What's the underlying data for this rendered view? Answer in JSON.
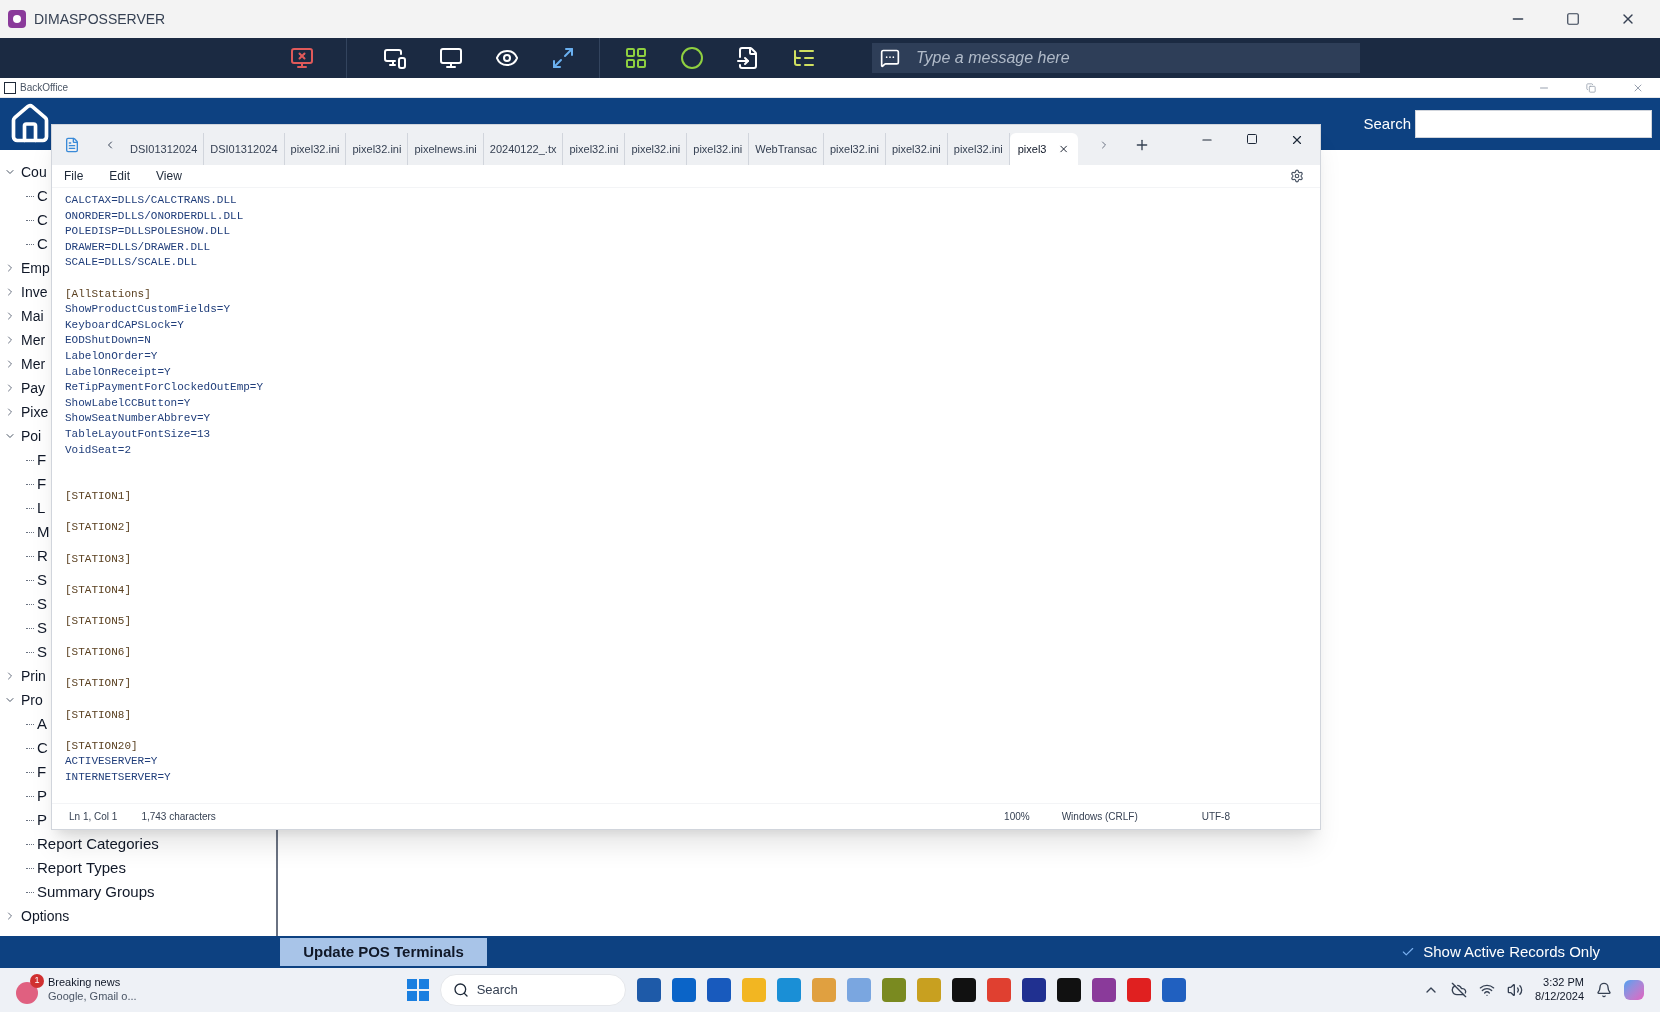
{
  "window": {
    "title": "DIMASPOSSERVER"
  },
  "remote_toolbar": {
    "message_field": {
      "placeholder": "Type a message here"
    }
  },
  "backoffice": {
    "title": "BackOffice",
    "search": {
      "label": "Search"
    },
    "tree": [
      {
        "label": "Cou",
        "expanded": true,
        "children": [
          {
            "label": "C"
          },
          {
            "label": "C"
          },
          {
            "label": "C"
          }
        ]
      },
      {
        "label": "Emp",
        "expanded": false
      },
      {
        "label": "Inve",
        "expanded": false
      },
      {
        "label": "Mai",
        "expanded": false
      },
      {
        "label": "Mer",
        "expanded": false
      },
      {
        "label": "Mer",
        "expanded": false
      },
      {
        "label": "Pay",
        "expanded": false
      },
      {
        "label": "Pixe",
        "expanded": false
      },
      {
        "label": "Poi",
        "expanded": true,
        "children": [
          {
            "label": "F"
          },
          {
            "label": "F"
          },
          {
            "label": "L"
          },
          {
            "label": "M"
          },
          {
            "label": "R"
          },
          {
            "label": "S"
          },
          {
            "label": "S"
          },
          {
            "label": "S"
          },
          {
            "label": "S"
          }
        ]
      },
      {
        "label": "Prin",
        "expanded": false
      },
      {
        "label": "Pro",
        "expanded": true,
        "children": [
          {
            "label": "A"
          },
          {
            "label": "C"
          },
          {
            "label": "F"
          },
          {
            "label": "P"
          },
          {
            "label": "P"
          },
          {
            "label": "Report Categories"
          },
          {
            "label": "Report Types"
          },
          {
            "label": "Summary Groups"
          }
        ]
      },
      {
        "label": "Options",
        "expanded": false
      }
    ],
    "update_button": "Update POS Terminals",
    "active_only": {
      "label": "Show Active Records Only",
      "checked": true
    }
  },
  "notepad": {
    "tabs": [
      {
        "label": "DSI01312024",
        "selected": false
      },
      {
        "label": "DSI01312024",
        "selected": false
      },
      {
        "label": "pixel32.ini",
        "selected": false
      },
      {
        "label": "pixel32.ini",
        "selected": false
      },
      {
        "label": "pixelnews.ini",
        "selected": false
      },
      {
        "label": "20240122_.tx",
        "selected": false
      },
      {
        "label": "pixel32.ini",
        "selected": false
      },
      {
        "label": "pixel32.ini",
        "selected": false
      },
      {
        "label": "pixel32.ini",
        "selected": false
      },
      {
        "label": "WebTransac",
        "selected": false
      },
      {
        "label": "pixel32.ini",
        "selected": false
      },
      {
        "label": "pixel32.ini",
        "selected": false
      },
      {
        "label": "pixel32.ini",
        "selected": false
      },
      {
        "label": "pixel3",
        "selected": true
      }
    ],
    "menu": [
      "File",
      "Edit",
      "View"
    ],
    "lines": [
      {
        "kind": "entry",
        "text": "CALCTAX=DLLS/CALCTRANS.DLL"
      },
      {
        "kind": "entry",
        "text": "ONORDER=DLLS/ONORDERDLL.DLL"
      },
      {
        "kind": "entry",
        "text": "POLEDISP=DLLSPOLESHOW.DLL"
      },
      {
        "kind": "entry",
        "text": "DRAWER=DLLS/DRAWER.DLL"
      },
      {
        "kind": "entry",
        "text": "SCALE=DLLS/SCALE.DLL"
      },
      {
        "kind": "blank"
      },
      {
        "kind": "section",
        "text": "[AllStations]"
      },
      {
        "kind": "entry",
        "text": "ShowProductCustomFields=Y"
      },
      {
        "kind": "entry",
        "text": "KeyboardCAPSLock=Y"
      },
      {
        "kind": "entry",
        "text": "EODShutDown=N"
      },
      {
        "kind": "entry",
        "text": "LabelOnOrder=Y"
      },
      {
        "kind": "entry",
        "text": "LabelOnReceipt=Y"
      },
      {
        "kind": "entry",
        "text": "ReTipPaymentForClockedOutEmp=Y"
      },
      {
        "kind": "entry",
        "text": "ShowLabelCCButton=Y"
      },
      {
        "kind": "entry",
        "text": "ShowSeatNumberAbbrev=Y"
      },
      {
        "kind": "entry",
        "text": "TableLayoutFontSize=13"
      },
      {
        "kind": "entry",
        "text": "VoidSeat=2"
      },
      {
        "kind": "blank"
      },
      {
        "kind": "blank"
      },
      {
        "kind": "section",
        "text": "[STATION1]"
      },
      {
        "kind": "blank"
      },
      {
        "kind": "section",
        "text": "[STATION2]"
      },
      {
        "kind": "blank"
      },
      {
        "kind": "section",
        "text": "[STATION3]"
      },
      {
        "kind": "blank"
      },
      {
        "kind": "section",
        "text": "[STATION4]"
      },
      {
        "kind": "blank"
      },
      {
        "kind": "section",
        "text": "[STATION5]"
      },
      {
        "kind": "blank"
      },
      {
        "kind": "section",
        "text": "[STATION6]"
      },
      {
        "kind": "blank"
      },
      {
        "kind": "section",
        "text": "[STATION7]"
      },
      {
        "kind": "blank"
      },
      {
        "kind": "section",
        "text": "[STATION8]"
      },
      {
        "kind": "blank"
      },
      {
        "kind": "section",
        "text": "[STATION20]"
      },
      {
        "kind": "entry",
        "text": "ACTIVESERVER=Y"
      },
      {
        "kind": "entry",
        "text": "INTERNETSERVER=Y"
      }
    ],
    "status": {
      "position": "Ln 1, Col 1",
      "characters": "1,743 characters",
      "zoom": "100%",
      "line_endings": "Windows (CRLF)",
      "encoding": "UTF-8"
    }
  },
  "taskbar": {
    "news": {
      "badge": "1",
      "title": "Breaking news",
      "subtitle": "Google, Gmail o..."
    },
    "search": {
      "placeholder": "Search"
    },
    "apps": [
      {
        "color": "#1e5aa8"
      },
      {
        "color": "#0a64c8"
      },
      {
        "color": "#185abd"
      },
      {
        "color": "#f2b622"
      },
      {
        "color": "#1a8fd6"
      },
      {
        "color": "#e0a040"
      },
      {
        "color": "#7aa6e0"
      },
      {
        "color": "#7a8a20"
      },
      {
        "color": "#c8a020"
      },
      {
        "color": "#111111"
      },
      {
        "color": "#e04030"
      },
      {
        "color": "#203090"
      },
      {
        "color": "#111111"
      },
      {
        "color": "#8a3a9a"
      },
      {
        "color": "#e02020"
      },
      {
        "color": "#2060c0"
      }
    ],
    "time": "3:32 PM",
    "date": "8/12/2024"
  }
}
